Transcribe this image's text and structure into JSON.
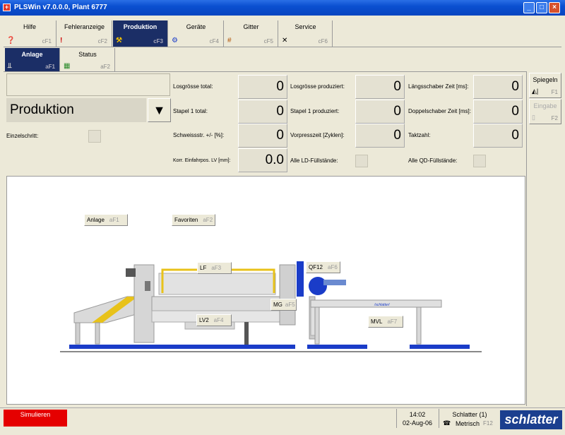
{
  "window": {
    "title": "PLSWin v7.0.0.0,  Plant 6777"
  },
  "ftabs": [
    {
      "label": "Hilfe",
      "key": "cF1",
      "icon": "help-icon"
    },
    {
      "label": "Fehleranzeige",
      "key": "cF2",
      "icon": "exclamation-icon"
    },
    {
      "label": "Produktion",
      "key": "cF3",
      "icon": "production-icon"
    },
    {
      "label": "Geräte",
      "key": "cF4",
      "icon": "devices-icon"
    },
    {
      "label": "Gitter",
      "key": "cF5",
      "icon": "grid-icon"
    },
    {
      "label": "Service",
      "key": "cF6",
      "icon": "tools-icon"
    }
  ],
  "subtabs": [
    {
      "label": "Anlage",
      "key": "aF1"
    },
    {
      "label": "Status",
      "key": "aF2"
    }
  ],
  "panel": {
    "product": "Produktion",
    "dropdown_arrow": "▼",
    "einzelschritt": "Einzelschritt:",
    "col1": [
      {
        "label": "Losgrösse total:",
        "value": "0"
      },
      {
        "label": "Stapel 1 total:",
        "value": "0"
      },
      {
        "label": "Schweissstr. +/- [%]:",
        "value": "0"
      },
      {
        "label": "Korr. Einfahrpos. LV [mm]:",
        "value": "0.0"
      }
    ],
    "col2": [
      {
        "label": "Losgrösse produziert:",
        "value": "0"
      },
      {
        "label": "Stapel 1 produziert:",
        "value": "0"
      },
      {
        "label": "Vorpresszeit [Zyklen]:",
        "value": "0"
      },
      {
        "label": "Alle LD-Füllstände:"
      }
    ],
    "col3": [
      {
        "label": "Längsschaber Zeit [ms]:",
        "value": "0"
      },
      {
        "label": "Doppelschaber Zeit [ms]:",
        "value": "0"
      },
      {
        "label": "Taktzahl:",
        "value": "0"
      },
      {
        "label": "Alle QD-Füllstände:"
      }
    ]
  },
  "right_buttons": [
    {
      "label": "Spiegeln",
      "key": "F1",
      "enabled": true
    },
    {
      "label": "Eingabe",
      "key": "F2",
      "enabled": false
    }
  ],
  "machine": {
    "anlage": {
      "label": "Anlage",
      "key": "aF1"
    },
    "favoriten": {
      "label": "Favoriten",
      "key": "aF2"
    },
    "lf": {
      "label": "LF",
      "key": "aF3"
    },
    "lv2": {
      "label": "LV2",
      "key": "aF4"
    },
    "mg": {
      "label": "MG",
      "key": "aF5"
    },
    "qf12": {
      "label": "QF12",
      "key": "aF6"
    },
    "mvl": {
      "label": "MVL",
      "key": "aF7"
    },
    "frame_brand": "/schlatter/",
    "colors": {
      "rail": "#1a3cc8",
      "accent": "#e8c21a",
      "frame": "#d8d8d8"
    }
  },
  "status": {
    "simulate": "Simulieren",
    "time": "14:02",
    "date": "02-Aug-06",
    "user": "Schlatter (1)",
    "units": "Metrisch",
    "units_key": "F12",
    "brand": "schlatter"
  }
}
